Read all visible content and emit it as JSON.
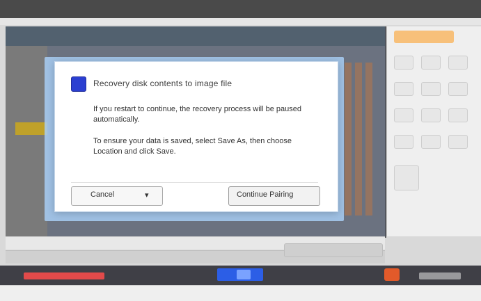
{
  "window": {
    "title": "",
    "right_panel_header": "",
    "action_button": "",
    "status_text": ""
  },
  "modal": {
    "title": "Recovery disk contents to image file",
    "bullets": [
      "If you restart to continue, the recovery process will be paused automatically.",
      "To ensure your data is saved, select Save As, then choose Location and click Save."
    ],
    "left_button_label": "Cancel",
    "right_button_label": "Continue Pairing"
  },
  "colors": {
    "modal_backdrop": "#a8cef5",
    "accent_blue": "#2b3fd1",
    "taskbar_blue": "#2c5ee6",
    "taskbar_red": "#e24a4a",
    "taskbar_orange": "#e25a2a",
    "highlight_yellow": "#bfa12a"
  },
  "icons": {
    "checkbox": "checkbox-icon",
    "dropdown": "chevron-down-icon"
  }
}
